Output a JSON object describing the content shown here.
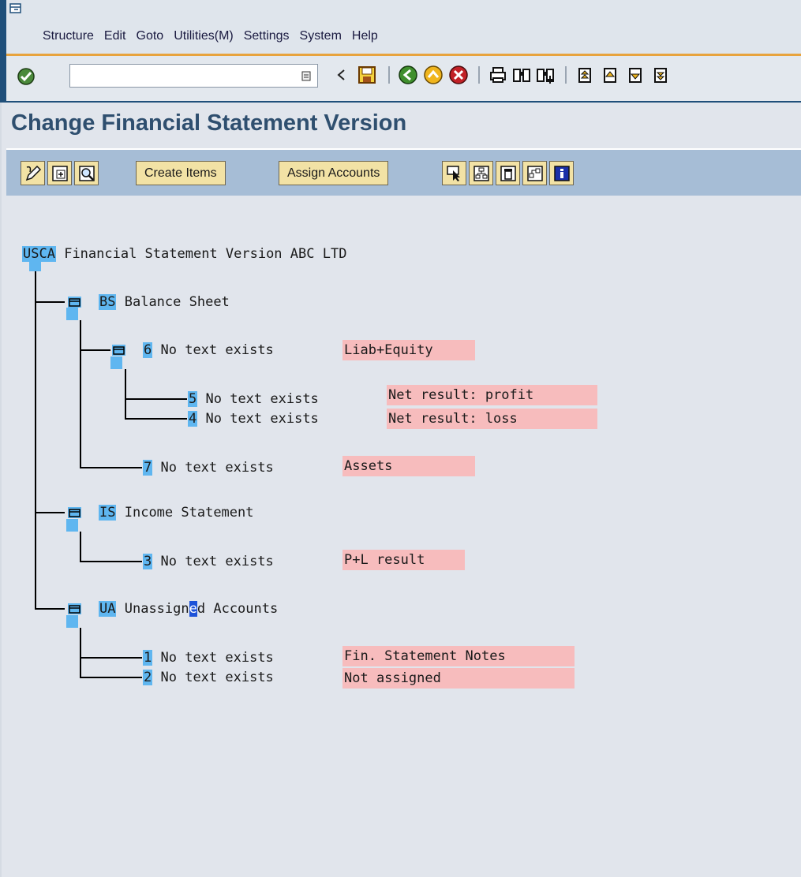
{
  "menu": {
    "items": [
      "Structure",
      "Edit",
      "Goto",
      "Utilities(M)",
      "Settings",
      "System",
      "Help"
    ]
  },
  "toolbar": {
    "command_value": "",
    "icons": [
      "enter-icon",
      "command-dropdown-icon",
      "back-arrow-icon",
      "save-icon",
      "back-icon",
      "exit-icon",
      "cancel-icon",
      "print-icon",
      "find-icon",
      "find-next-icon",
      "first-page-icon",
      "previous-page-icon",
      "next-page-icon",
      "last-page-icon"
    ]
  },
  "page": {
    "title": "Change Financial Statement Version"
  },
  "app_toolbar": {
    "create_items": "Create Items",
    "assign_accounts": "Assign Accounts",
    "icons": [
      "edit-icon",
      "expand-icon",
      "zoom-icon",
      "select-icon",
      "structure-icon",
      "delete-icon",
      "move-icon",
      "info-icon"
    ]
  },
  "tree": {
    "root": {
      "key": "USCA",
      "text": "Financial Statement Version ABC LTD"
    },
    "bs": {
      "key": "BS",
      "text": "Balance Sheet"
    },
    "n6": {
      "key": "6",
      "text": "No text exists",
      "label": "Liab+Equity"
    },
    "n5": {
      "key": "5",
      "text": "No text exists",
      "label": "Net result: profit"
    },
    "n4": {
      "key": "4",
      "text": "No text exists",
      "label": "Net result: loss"
    },
    "n7": {
      "key": "7",
      "text": "No text exists",
      "label": "Assets"
    },
    "is": {
      "key": "IS",
      "text": "Income Statement"
    },
    "n3": {
      "key": "3",
      "text": "No text exists",
      "label": "P+L result"
    },
    "ua": {
      "key": "UA",
      "text_before": "Unassign",
      "text_cursor": "e",
      "text_after": "d Accounts"
    },
    "n1": {
      "key": "1",
      "text": "No text exists",
      "label": "Fin. Statement Notes"
    },
    "n2": {
      "key": "2",
      "text": "No text exists",
      "label": "Not assigned"
    }
  },
  "colors": {
    "accent_line": "#e8a33d",
    "title": "#2f4f6f",
    "node_key": "#5fb6f0",
    "label_bg": "#f7bcbd",
    "app_toolbar": "#a6bdd6"
  }
}
